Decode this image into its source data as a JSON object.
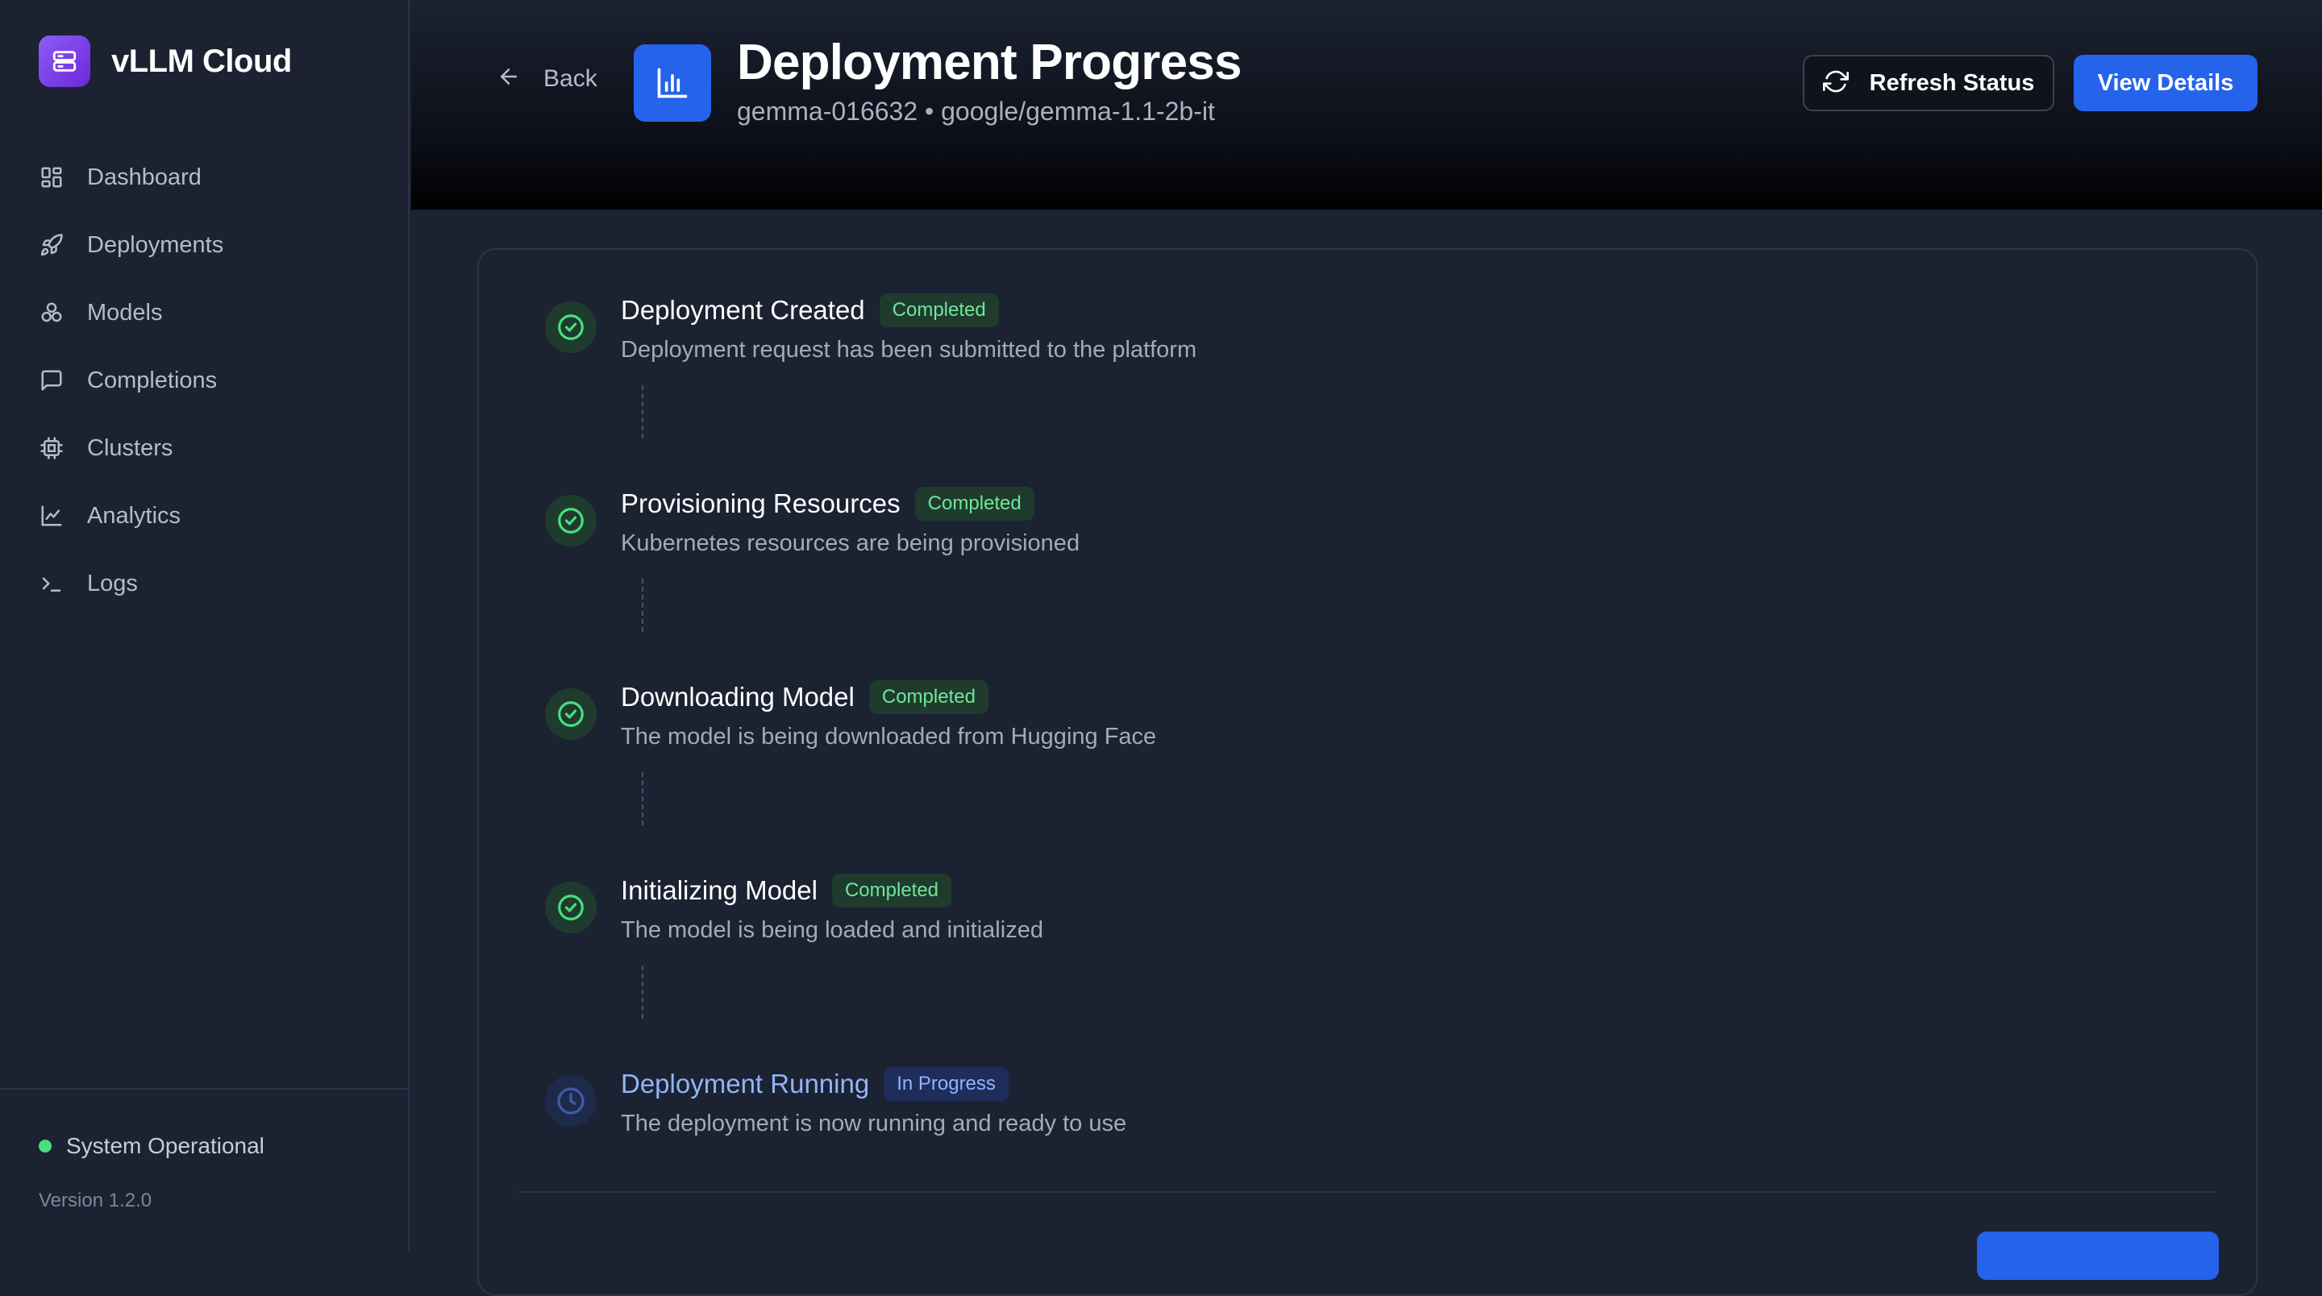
{
  "app": {
    "name": "vLLM Cloud"
  },
  "sidebar": {
    "items": [
      {
        "label": "Dashboard",
        "icon": "dashboard-icon"
      },
      {
        "label": "Deployments",
        "icon": "rocket-icon"
      },
      {
        "label": "Models",
        "icon": "models-icon"
      },
      {
        "label": "Completions",
        "icon": "chat-icon"
      },
      {
        "label": "Clusters",
        "icon": "chip-icon"
      },
      {
        "label": "Analytics",
        "icon": "chart-line-icon"
      },
      {
        "label": "Logs",
        "icon": "terminal-icon"
      }
    ],
    "status": "System Operational",
    "status_color": "#4ade80",
    "version": "Version 1.2.0"
  },
  "header": {
    "back_label": "Back",
    "title": "Deployment Progress",
    "subtitle": "gemma-016632 • google/gemma-1.1-2b-it",
    "refresh_label": "Refresh Status",
    "view_label": "View Details",
    "accent": "#2563eb"
  },
  "steps": [
    {
      "title": "Deployment Created",
      "status": "Completed",
      "description": "Deployment request has been submitted to the platform"
    },
    {
      "title": "Provisioning Resources",
      "status": "Completed",
      "description": "Kubernetes resources are being provisioned"
    },
    {
      "title": "Downloading Model",
      "status": "Completed",
      "description": "The model is being downloaded from Hugging Face"
    },
    {
      "title": "Initializing Model",
      "status": "Completed",
      "description": "The model is being loaded and initialized"
    },
    {
      "title": "Deployment Running",
      "status": "In Progress",
      "description": "The deployment is now running and ready to use"
    }
  ]
}
